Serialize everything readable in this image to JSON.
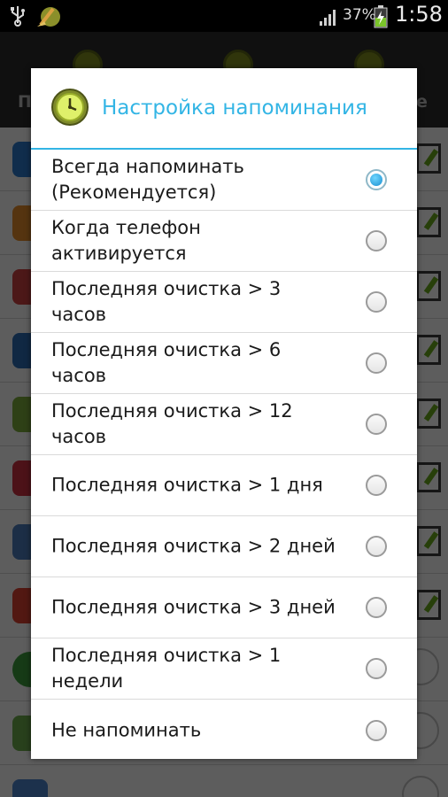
{
  "status_bar": {
    "usb_icon": "usb-icon",
    "app_icon": "cleaner-broom-icon",
    "signal_icon": "signal-bars-icon",
    "battery_percent": "37%",
    "battery_icon": "battery-charging-icon",
    "time": "1:58"
  },
  "background_app": {
    "tab_left_initial": "П",
    "tab_right_suffix": "е"
  },
  "dialog": {
    "icon": "clock-icon",
    "title": "Настройка напоминания",
    "accent_color": "#33b5e5",
    "options": [
      {
        "label": "Всегда напоминать\n(Рекомендуется)",
        "selected": true
      },
      {
        "label": "Когда телефон\nактивируется",
        "selected": false
      },
      {
        "label": "Последняя очистка > 3\nчасов",
        "selected": false
      },
      {
        "label": "Последняя очистка > 6\nчасов",
        "selected": false
      },
      {
        "label": "Последняя очистка > 12\nчасов",
        "selected": false
      },
      {
        "label": "Последняя очистка > 1 дня",
        "selected": false
      },
      {
        "label": "Последняя очистка > 2 дней",
        "selected": false
      },
      {
        "label": "Последняя очистка > 3 дней",
        "selected": false
      },
      {
        "label": "Последняя очистка > 1\nнедели",
        "selected": false
      },
      {
        "label": "Не напоминать",
        "selected": false
      }
    ]
  }
}
